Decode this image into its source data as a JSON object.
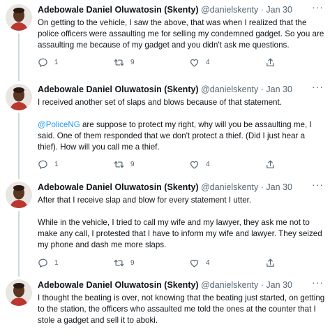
{
  "tweets": [
    {
      "name": "Adebowale Daniel Oluwatosin (Skenty)",
      "handle": "@danielskenty",
      "separator": "·",
      "time": "Jan 30",
      "paragraphs": [
        "On getting to the vehicle, I saw the above, that was when I realized that the police officers were assaulting me for selling my condemned gadget. So you are assaulting me because of my gadget and you didn't ask me questions."
      ],
      "replies": "1",
      "retweets": "9",
      "likes": "4"
    },
    {
      "name": "Adebowale Daniel Oluwatosin (Skenty)",
      "handle": "@danielskenty",
      "separator": "·",
      "time": "Jan 30",
      "p1": "I received another set of slaps and blows because of that statement.",
      "mention": "@PoliceNG",
      "p2_rest": " are suppose to protect my right, why will you be assaulting me, I said. One of them responded that we don't protect a thief. (Did I just hear a thief). How will you call me a thief.",
      "replies": "1",
      "retweets": "9",
      "likes": "4"
    },
    {
      "name": "Adebowale Daniel Oluwatosin (Skenty)",
      "handle": "@danielskenty",
      "separator": "·",
      "time": "Jan 30",
      "paragraphs": [
        "After that I receive slap and blow for every statement I utter.",
        "While in the vehicle, I tried to call my wife and my lawyer, they ask me not to make any call, I protested that I have to inform my wife and lawyer. They seized my phone and dash me more slaps."
      ],
      "replies": "1",
      "retweets": "9",
      "likes": "4"
    },
    {
      "name": "Adebowale Daniel Oluwatosin (Skenty)",
      "handle": "@danielskenty",
      "separator": "·",
      "time": "Jan 30",
      "paragraphs": [
        "I thought the beating is over, not knowing that the beating just started, on getting to the station, the officers who assaulted me told the ones at the counter that I stole a gadget and sell it to aboki."
      ]
    }
  ],
  "icons": {
    "reply": "reply-icon",
    "retweet": "retweet-icon",
    "like": "heart-icon",
    "share": "share-icon",
    "more": "more-icon"
  },
  "colors": {
    "link": "#1d9bf0",
    "secondary_text": "#536471",
    "thread_line": "#cfd9de"
  }
}
